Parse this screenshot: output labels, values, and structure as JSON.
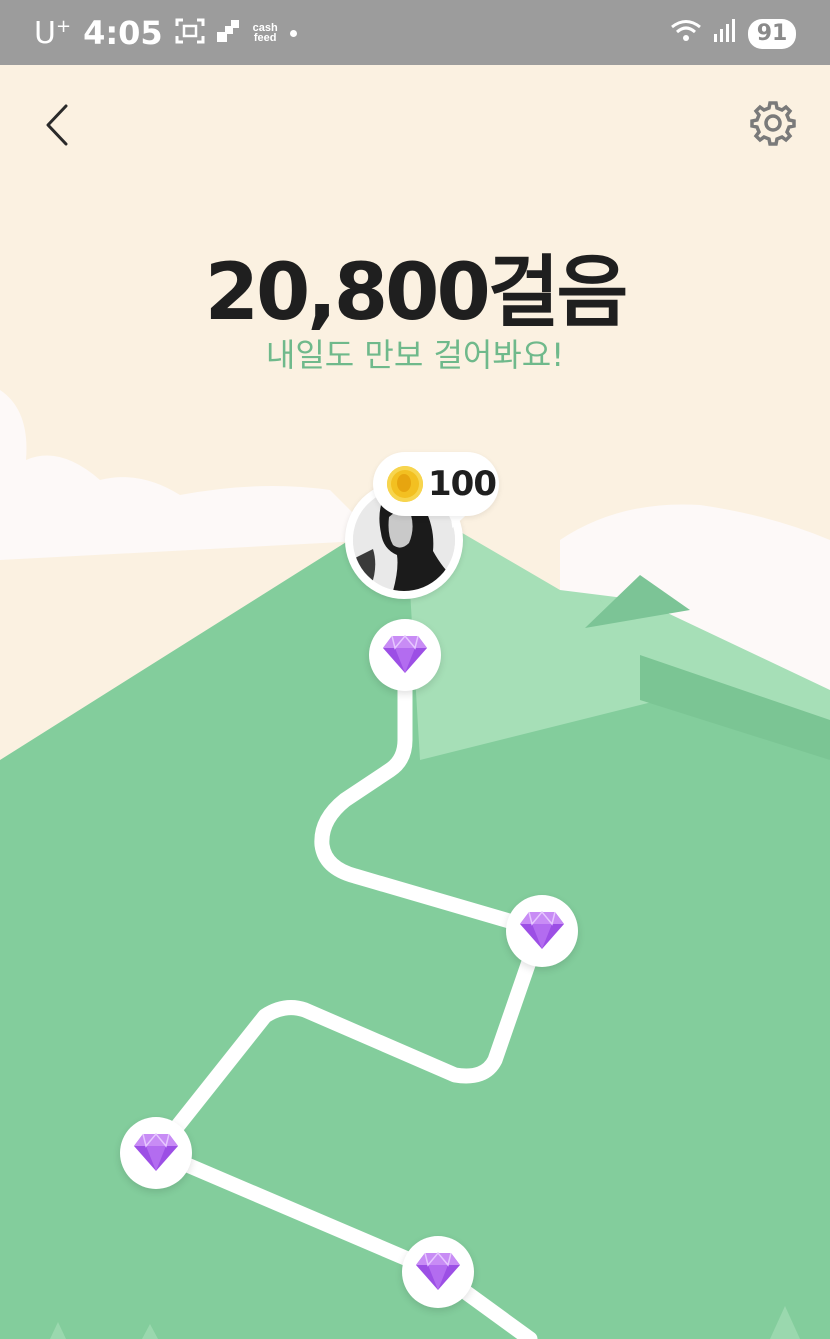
{
  "status_bar": {
    "carrier": "U",
    "carrier_sup": "+",
    "time": "4:05",
    "cash_line1": "cash",
    "cash_line2": "feed",
    "battery": "91"
  },
  "header": {
    "back_icon": "chevron-left-icon",
    "settings_icon": "gear-icon"
  },
  "main": {
    "steps": "20,800걸음",
    "subtitle": "내일도 만보 걸어봐요!"
  },
  "reward": {
    "coins": "100",
    "coin_icon": "coin-icon"
  },
  "path": {
    "milestone_icon": "diamond-gem-icon",
    "milestone_count": 4
  },
  "colors": {
    "background": "#fbf1e1",
    "mountain": "#83cd9c",
    "subtitle": "#6fb98b",
    "gem": "#9c4fe5"
  }
}
